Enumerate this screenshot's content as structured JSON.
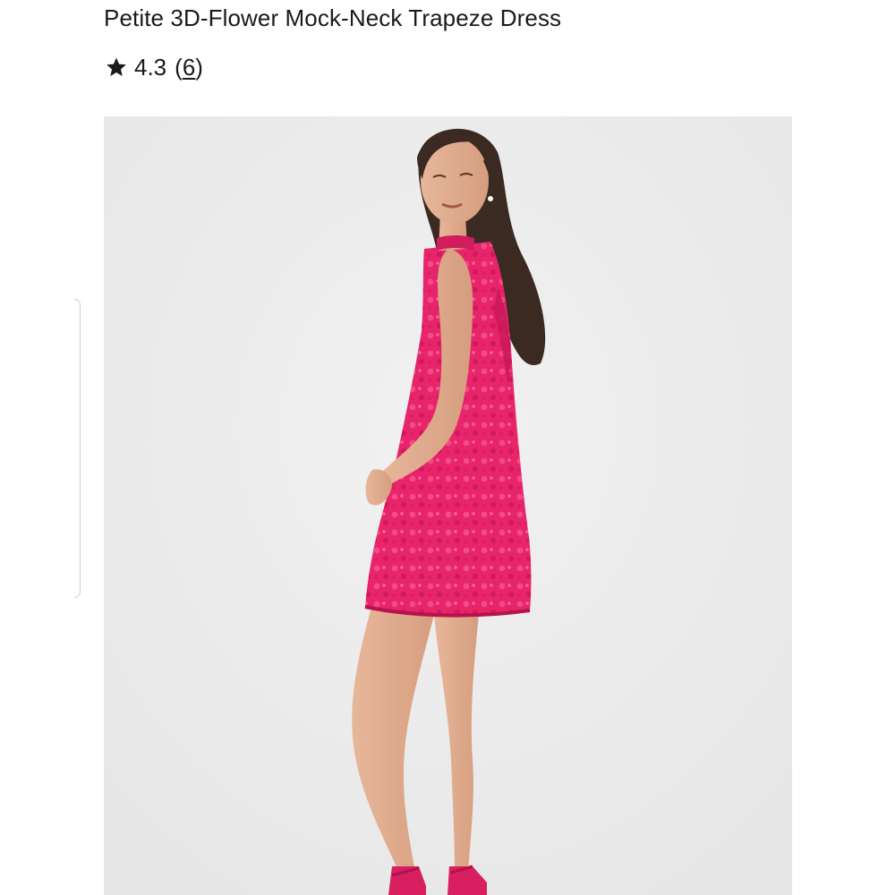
{
  "product": {
    "title": "Petite 3D-Flower Mock-Neck Trapeze Dress",
    "rating_value": "4.3",
    "review_count": "6",
    "rating_icon": "star-icon",
    "image_alt": "Model wearing pink 3D-flower mock-neck trapeze dress, side view"
  },
  "colors": {
    "text": "#1a1a1a",
    "dress_pink": "#e8246a",
    "image_background": "#ececec"
  }
}
